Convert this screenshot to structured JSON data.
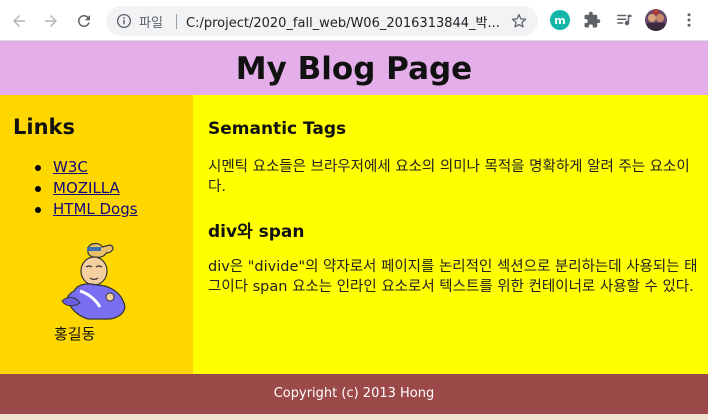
{
  "browser": {
    "back_icon": "arrow-left-icon",
    "forward_icon": "arrow-right-icon",
    "reload_icon": "reload-icon",
    "info_icon": "info-icon",
    "site_chip": "파일",
    "url": "C:/project/2020_fall_web/W06_2016313844_박...",
    "bookmark_icon": "star-icon",
    "extension_m_label": "m",
    "extensions_icon": "puzzle-icon",
    "media_icon": "media-queue-icon",
    "profile_icon": "avatar",
    "menu_icon": "kebab-menu-icon"
  },
  "page": {
    "title": "My Blog Page",
    "sidebar": {
      "heading": "Links",
      "links": [
        {
          "label": "W3C"
        },
        {
          "label": "MOZILLA"
        },
        {
          "label": "HTML Dogs"
        }
      ],
      "portrait_caption": "홍길동"
    },
    "main": {
      "section1_title": "Semantic Tags",
      "section1_text": "시멘틱 요소들은 브라우저에세 요소의 의미나 목적을 명확하게 알려 주는 요소이다.",
      "section2_title": "div와 span",
      "section2_text": "div은 \"divide\"의 약자로서 페이지를 논리적인 섹션으로 분리하는데 사용되는 태그이다 span 요소는 인라인 요소로서 텍스트를 위한 컨테이너로 사용할 수 있다."
    },
    "footer": "Copyright (c) 2013 Hong"
  },
  "colors": {
    "header_bg": "#e3aeea",
    "sidebar_bg": "#ffd700",
    "main_bg": "#ffff00",
    "footer_bg": "#9c4949",
    "link": "#12067a"
  }
}
